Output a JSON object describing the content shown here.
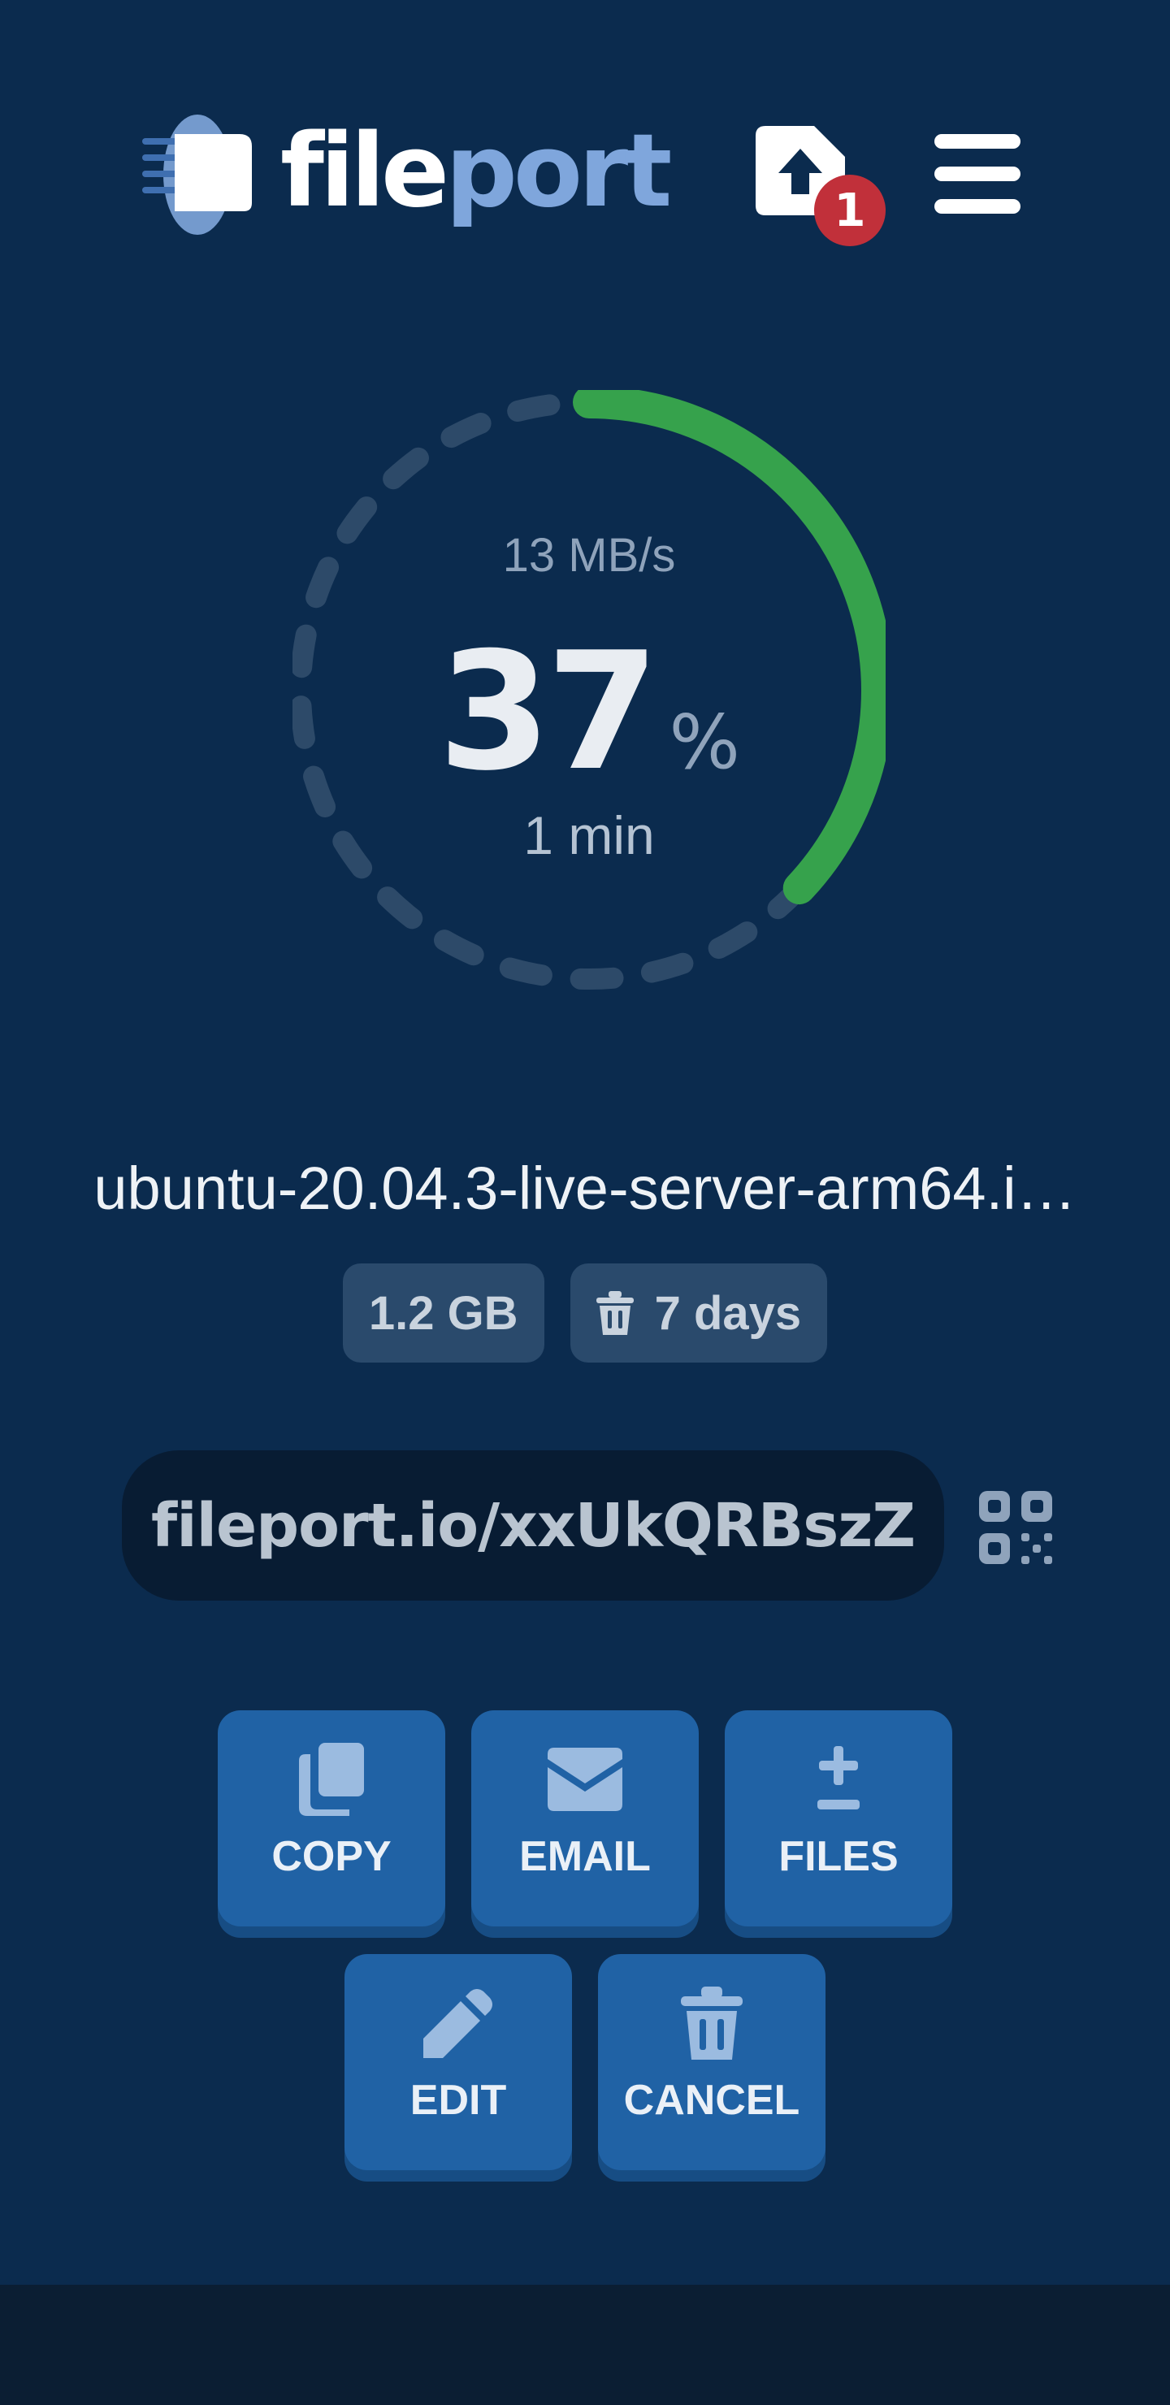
{
  "app": {
    "logo_part1": "file",
    "logo_part2": "port",
    "upload_badge_count": "1",
    "menu_icon": "hamburger-menu-icon",
    "upload_icon": "upload-file-icon"
  },
  "transfer": {
    "speed": "13 MB/s",
    "percent": "37",
    "percent_sign": "%",
    "eta": "1 min",
    "progress_fraction": 0.37
  },
  "file": {
    "name": "ubuntu-20.04.3-live-server-arm64.i…",
    "size": "1.2 GB",
    "expiry": "7 days",
    "expiry_icon": "trash-icon"
  },
  "share": {
    "link": "fileport.io/xxUkQRBszZ",
    "qr_icon": "qr-code-icon"
  },
  "actions": [
    {
      "label": "COPY",
      "icon": "copy-icon"
    },
    {
      "label": "EMAIL",
      "icon": "envelope-icon"
    },
    {
      "label": "FILES",
      "icon": "add-file-icon"
    },
    {
      "label": "EDIT",
      "icon": "pencil-icon"
    },
    {
      "label": "CANCEL",
      "icon": "trash-icon"
    }
  ],
  "colors": {
    "background": "#0b2b4e",
    "progress": "#36a24c",
    "button": "#2062a5",
    "badge": "#c1303a"
  }
}
